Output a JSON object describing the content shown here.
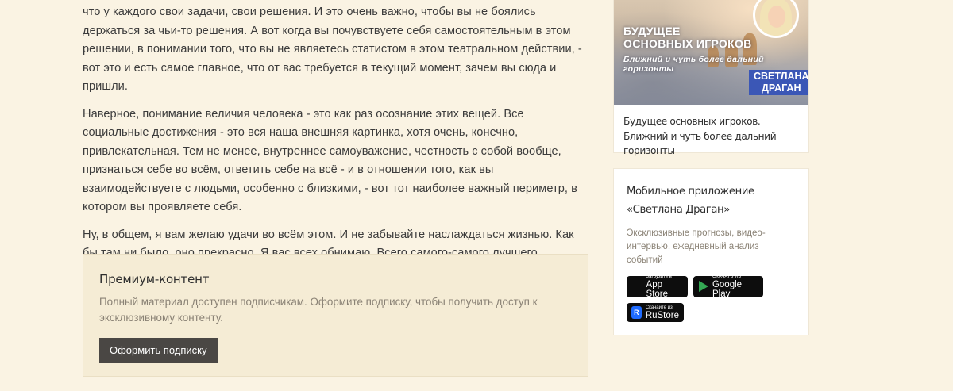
{
  "article": {
    "paragraphs": [
      "что у каждого свои задачи, свои решения. И это очень важно, чтобы вы не боялись держаться за чьи-то решения. А вот когда вы почувствуете себя самостоятельным в этом решении, в понимании того, что вы не являетесь статистом в этом театральном действии, - вот это и есть самое главное, что от вас требуется в текущий момент, зачем вы сюда и пришли.",
      "Наверное, понимание величия человека - это как раз осознание этих вещей. Все социальные достижения - это вся наша внешняя картинка, хотя очень, конечно, привлекательная. Тем не менее, внутреннее самоуважение, честность с собой вообще, признаться себе во всём, ответить себе на всё - и в отношении того, как вы взаимодействуете с людьми, особенно с близкими, - вот тот наиболее важный периметр, в котором вы проявляете себя.",
      "Ну, в общем, я вам желаю удачи во всём этом. И не забывайте наслаждаться жизнью. Как бы там ни было, оно прекрасно. Я вас всех обнимаю. Всего самого-самого лучшего."
    ]
  },
  "premium": {
    "title": "Премиум-контент",
    "text": "Полный материал доступен подписчикам. Оформите подписку, чтобы получить доступ к эксклюзивному контенту.",
    "button": "Оформить подписку"
  },
  "sidebar": {
    "video_card": {
      "thumb_line1": "Будущее",
      "thumb_line2": "основных игроков",
      "thumb_line3": "Ближний и чуть более дальний горизонты",
      "thumb_name1": "Светлана",
      "thumb_name2": "Драган",
      "caption": "Будущее основных игроков. Ближний и чуть более дальний горизонты"
    },
    "app_card": {
      "title": "Мобильное приложение «Светлана Драган»",
      "description": "Эксклюзивные прогнозы, видео-интервью, ежедневный анализ событий",
      "app_store": {
        "small": "Загрузите в",
        "big": "App Store",
        "icon": "apple-icon"
      },
      "google_play": {
        "small": "СКАЧАТЬ ИЗ",
        "big": "Google Play",
        "icon": "google-play-icon"
      },
      "rustore": {
        "small": "Скачайте из",
        "big": "RuStore",
        "icon": "rustore-icon"
      }
    }
  },
  "colors": {
    "page_background": "#faf3e3",
    "premium_background": "#f5ecd5",
    "button_background": "#4a4744",
    "name_badge": "#3b57b6"
  }
}
